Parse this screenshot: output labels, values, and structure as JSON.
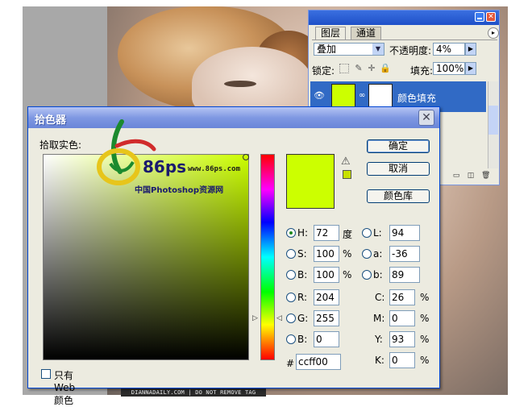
{
  "footer_tag": "DIANNADAILY.COM | DO NOT REMOVE TAG",
  "layers_panel": {
    "tabs": [
      "图层",
      "通道"
    ],
    "blend_mode": "叠加",
    "opacity_label": "不透明度:",
    "opacity_value": "4%",
    "lock_label": "锁定:",
    "fill_label": "填充:",
    "fill_value": "100%",
    "layer_name": "颜色填充",
    "layer_color": "#ccff00"
  },
  "picker": {
    "title": "拾色器",
    "prompt": "拾取实色:",
    "buttons": {
      "ok": "确定",
      "cancel": "取消",
      "library": "颜色库"
    },
    "watermark": {
      "brand": "86ps",
      "url": "www.86ps.com",
      "subtitle": "中国Photoshop资源网"
    },
    "hsb": [
      {
        "name": "H:",
        "value": "72",
        "unit": "度",
        "selected": true
      },
      {
        "name": "S:",
        "value": "100",
        "unit": "%",
        "selected": false
      },
      {
        "name": "B:",
        "value": "100",
        "unit": "%",
        "selected": false
      }
    ],
    "rgb": [
      {
        "name": "R:",
        "value": "204"
      },
      {
        "name": "G:",
        "value": "255"
      },
      {
        "name": "B:",
        "value": "0"
      }
    ],
    "lab": [
      {
        "name": "L:",
        "value": "94"
      },
      {
        "name": "a:",
        "value": "-36"
      },
      {
        "name": "b:",
        "value": "89"
      }
    ],
    "cmyk": [
      {
        "name": "C:",
        "value": "26",
        "unit": "%"
      },
      {
        "name": "M:",
        "value": "0",
        "unit": "%"
      },
      {
        "name": "Y:",
        "value": "93",
        "unit": "%"
      },
      {
        "name": "K:",
        "value": "0",
        "unit": "%"
      }
    ],
    "hex_label": "#",
    "hex_value": "ccff00",
    "web_only_label": "只有 Web 颜色",
    "current_color": "#ccff00"
  }
}
